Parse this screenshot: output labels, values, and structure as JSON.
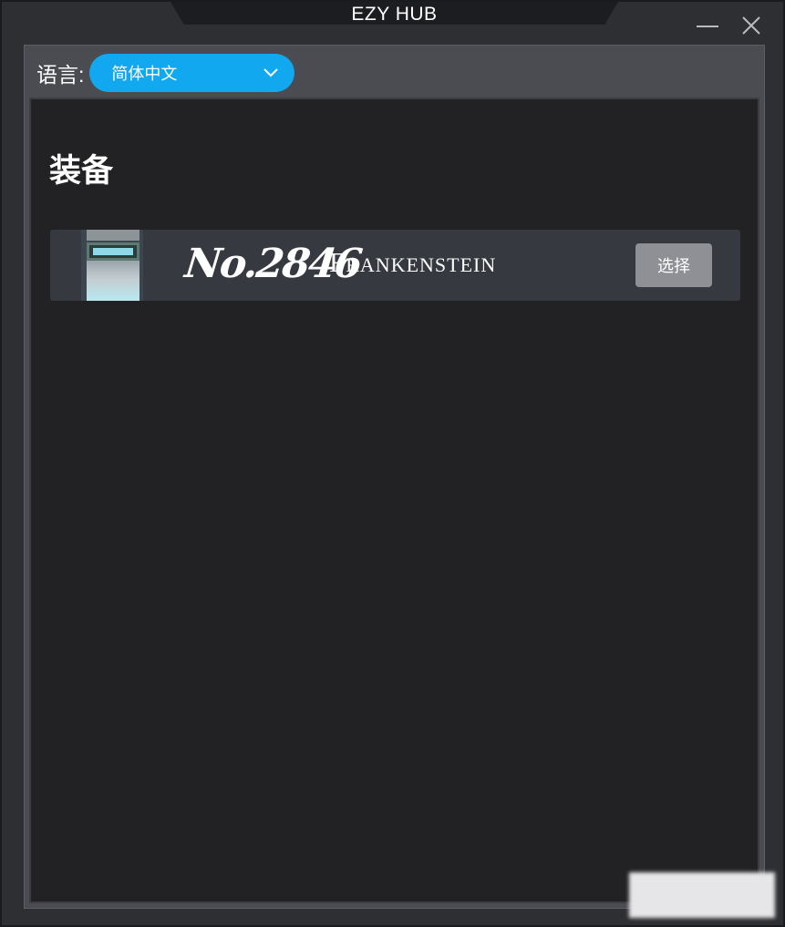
{
  "window": {
    "title": "EZY HUB"
  },
  "language": {
    "label": "语言:",
    "selected": "简体中文"
  },
  "section": {
    "title": "装备"
  },
  "items": [
    {
      "number": "No.2846",
      "name": "Frankenstein",
      "action_label": "选择"
    }
  ],
  "colors": {
    "accent": "#12a8f0",
    "background": "#222225",
    "row": "#373941",
    "button": "#8e9096"
  },
  "icons": {
    "minimize": "minimize-icon",
    "close": "close-icon",
    "dropdown": "chevron-down-icon"
  }
}
